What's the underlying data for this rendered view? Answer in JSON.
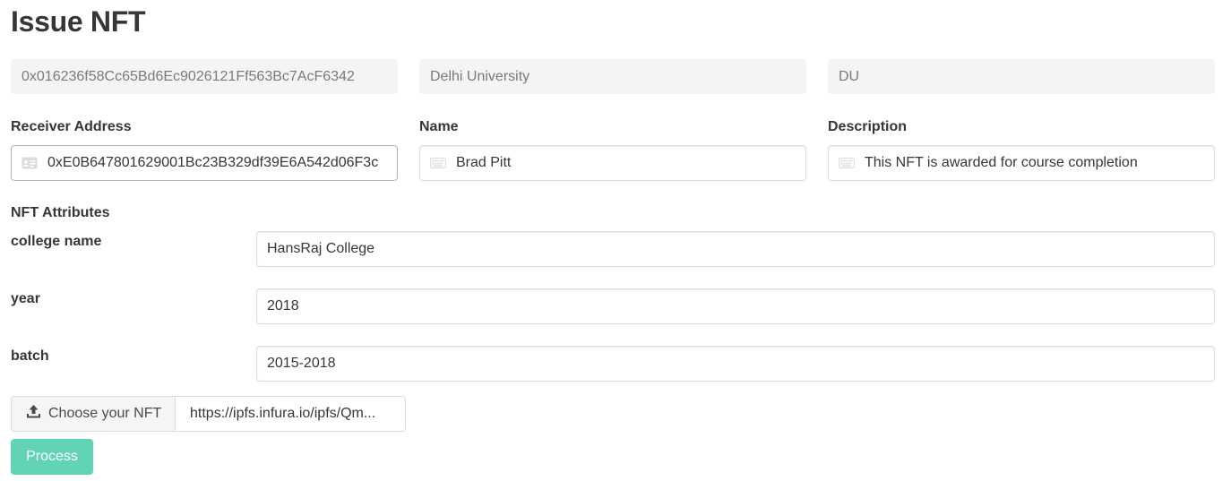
{
  "page_title": "Issue NFT",
  "issuer": {
    "address": "0x016236f58Cc65Bd6Ec9026121Ff563Bc7AcF6342",
    "organization": "Delhi University",
    "symbol": "DU"
  },
  "form": {
    "receiver": {
      "label": "Receiver Address",
      "value": "0xE0B647801629001Bc23B329df39E6A542d06F3c",
      "icon": "id-card-icon"
    },
    "name": {
      "label": "Name",
      "value": "Brad Pitt",
      "icon": "keyboard-icon"
    },
    "description": {
      "label": "Description",
      "value": "This NFT is awarded for course completion",
      "icon": "keyboard-icon"
    }
  },
  "attributes": {
    "heading": "NFT Attributes",
    "items": [
      {
        "label": "college name",
        "value": "HansRaj College"
      },
      {
        "label": "year",
        "value": "2018"
      },
      {
        "label": "batch",
        "value": "2015-2018"
      }
    ]
  },
  "upload": {
    "button_label": "Choose your NFT",
    "file_name": "https://ipfs.infura.io/ipfs/Qm...",
    "icon": "upload-icon"
  },
  "submit": {
    "label": "Process",
    "color": "#62d4b6"
  }
}
